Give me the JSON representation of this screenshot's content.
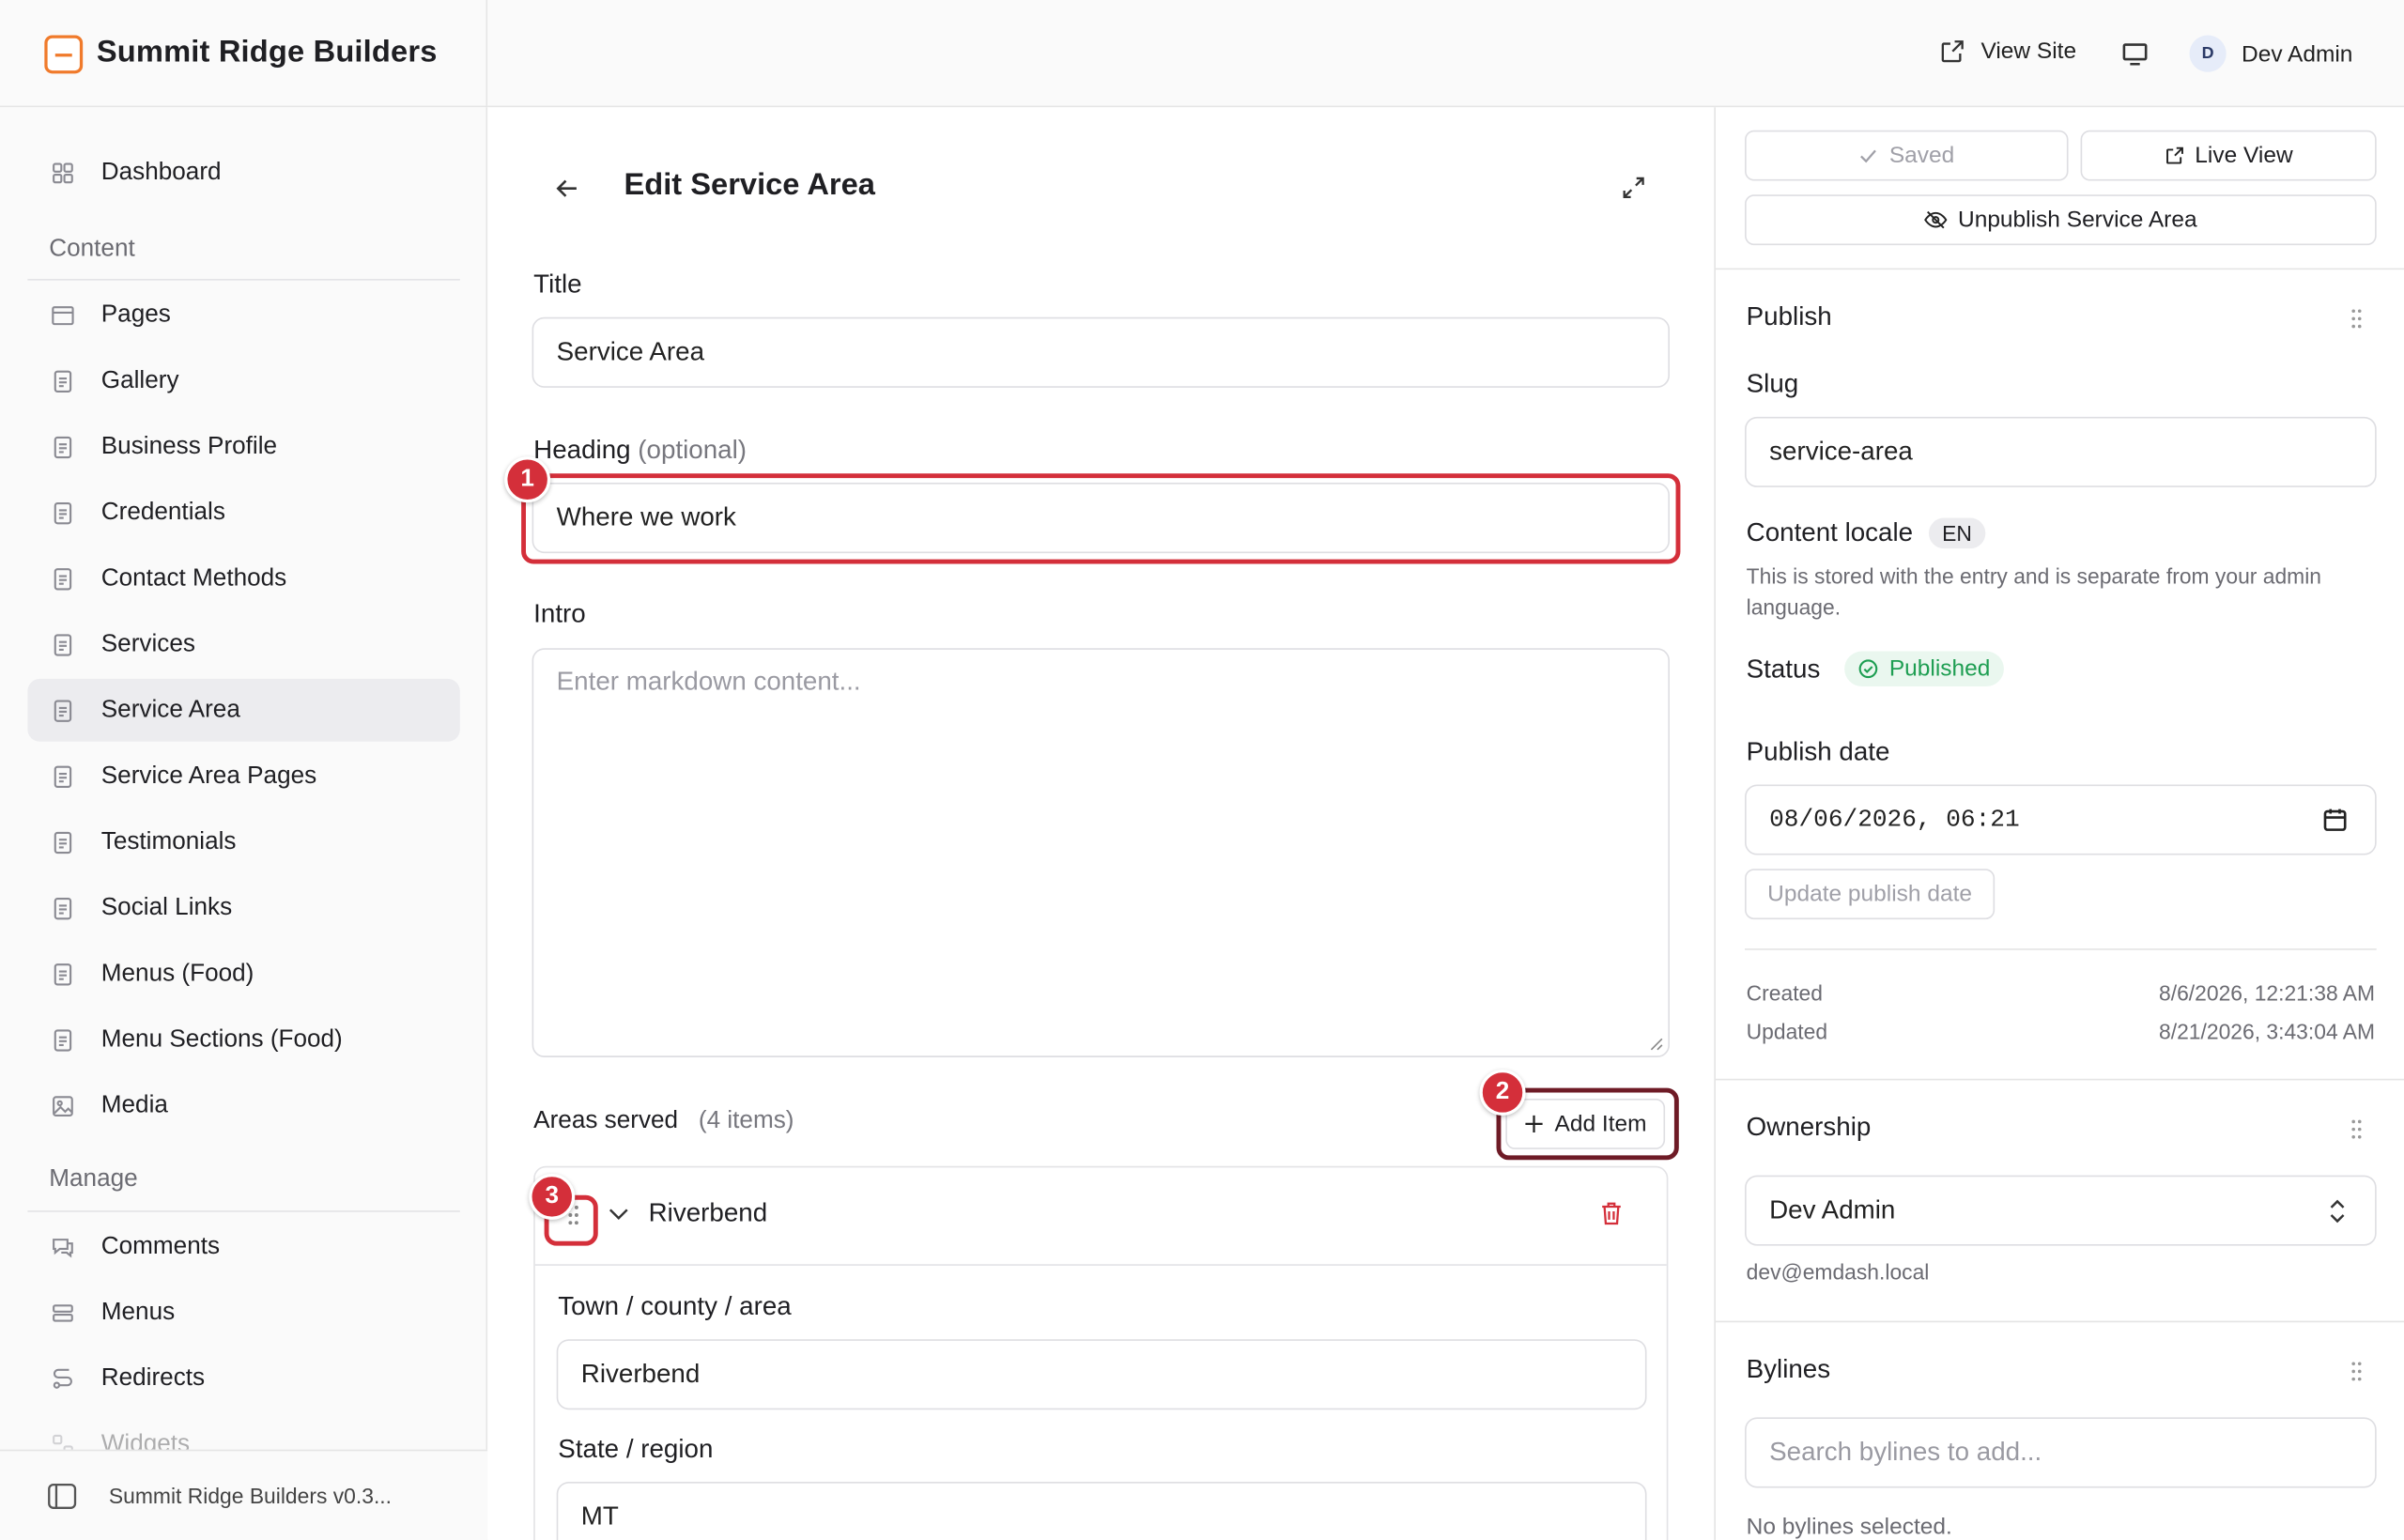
{
  "brand": {
    "name": "Summit Ridge Builders"
  },
  "topbar": {
    "view_site": "View Site",
    "user_initial": "D",
    "user_name": "Dev Admin"
  },
  "sidebar": {
    "dashboard": "Dashboard",
    "content_heading": "Content",
    "content_items": [
      "Pages",
      "Gallery",
      "Business Profile",
      "Credentials",
      "Contact Methods",
      "Services",
      "Service Area",
      "Service Area Pages",
      "Testimonials",
      "Social Links",
      "Menus (Food)",
      "Menu Sections (Food)",
      "Media"
    ],
    "manage_heading": "Manage",
    "manage_items": [
      "Comments",
      "Menus",
      "Redirects",
      "Widgets"
    ],
    "footer": "Summit Ridge Builders v0.3..."
  },
  "editor": {
    "title": "Edit Service Area",
    "title_label": "Title",
    "title_value": "Service Area",
    "heading_label": "Heading",
    "heading_optional": "(optional)",
    "heading_value": "Where we work",
    "intro_label": "Intro",
    "intro_placeholder": "Enter markdown content...",
    "areas_label": "Areas served",
    "areas_count": "(4 items)",
    "add_item": "Add Item",
    "item": {
      "name": "Riverbend",
      "town_label": "Town / county / area",
      "town_value": "Riverbend",
      "state_label": "State / region",
      "state_value": "MT"
    },
    "badges": [
      "1",
      "2",
      "3"
    ]
  },
  "panel": {
    "saved": "Saved",
    "live_view": "Live View",
    "unpublish": "Unpublish Service Area",
    "publish_title": "Publish",
    "slug_label": "Slug",
    "slug_value": "service-area",
    "locale_label": "Content locale",
    "locale_value": "EN",
    "locale_help": "This is stored with the entry and is separate from your admin language.",
    "status_label": "Status",
    "status_value": "Published",
    "publish_date_label": "Publish date",
    "publish_date_value": "08/06/2026, 06:21",
    "update_publish_date": "Update publish date",
    "created_label": "Created",
    "created_value": "8/6/2026, 12:21:38 AM",
    "updated_label": "Updated",
    "updated_value": "8/21/2026, 3:43:04 AM",
    "ownership_title": "Ownership",
    "owner_value": "Dev Admin",
    "owner_email": "dev@emdash.local",
    "bylines_title": "Bylines",
    "bylines_placeholder": "Search bylines to add...",
    "no_bylines": "No bylines selected."
  },
  "colors": {
    "accent_red": "#d42f3a",
    "brand_orange": "#f07a2b",
    "published_green": "#1e9e52"
  }
}
